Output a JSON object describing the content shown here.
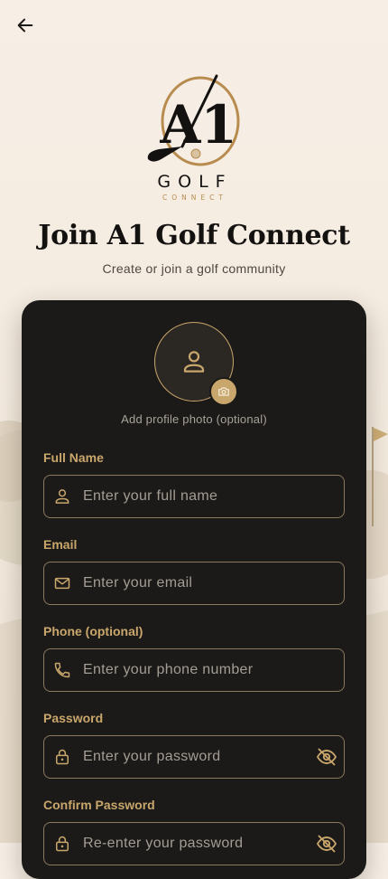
{
  "colors": {
    "accent": "#c9a66b",
    "card_background": "#1b1a18",
    "page_background": "#f4ebe0"
  },
  "header": {
    "back_icon": "arrow-left-icon"
  },
  "logo": {
    "mark": "A1",
    "wordmark": "GOLF",
    "tagline": "CONNECT"
  },
  "title": "Join A1 Golf Connect",
  "subtitle": "Create or join a golf community",
  "profile_photo": {
    "icon": "person-icon",
    "badge_icon": "camera-icon",
    "caption": "Add profile photo (optional)"
  },
  "form": {
    "fields": [
      {
        "label": "Full Name",
        "placeholder": "Enter your full name",
        "icon": "person-icon"
      },
      {
        "label": "Email",
        "placeholder": "Enter your email",
        "icon": "mail-icon"
      },
      {
        "label": "Phone (optional)",
        "placeholder": "Enter your phone number",
        "icon": "phone-icon"
      },
      {
        "label": "Password",
        "placeholder": "Enter your password",
        "icon": "lock-icon",
        "toggle_icon": "eye-off-icon"
      },
      {
        "label": "Confirm Password",
        "placeholder": "Re-enter your password",
        "icon": "lock-icon",
        "toggle_icon": "eye-off-icon"
      }
    ]
  }
}
